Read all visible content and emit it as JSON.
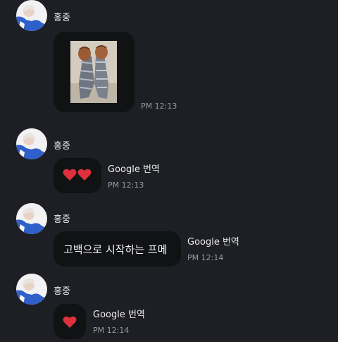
{
  "colors": {
    "background": "#1e1f24",
    "bubble": "#111214",
    "heart": "#e0303e",
    "time_text": "#9a9aa3"
  },
  "messages": [
    {
      "sender": "홍중",
      "avatar_icon": "profile-avatar",
      "content_type": "photo",
      "photo_icon": "shoes-photo",
      "time": "PM 12:13"
    },
    {
      "sender": "홍중",
      "avatar_icon": "profile-avatar",
      "content_type": "emoji",
      "emoji_icons": [
        "heart-icon",
        "heart-icon"
      ],
      "translate_label": "Google 번역",
      "time": "PM 12:13"
    },
    {
      "sender": "홍중",
      "avatar_icon": "profile-avatar",
      "content_type": "text",
      "text": "고백으로 시작하는 프메",
      "translate_label": "Google 번역",
      "time": "PM 12:14"
    },
    {
      "sender": "홍중",
      "avatar_icon": "profile-avatar",
      "content_type": "emoji",
      "emoji_icons": [
        "heart-icon"
      ],
      "translate_label": "Google 번역",
      "time": "PM 12:14"
    }
  ]
}
